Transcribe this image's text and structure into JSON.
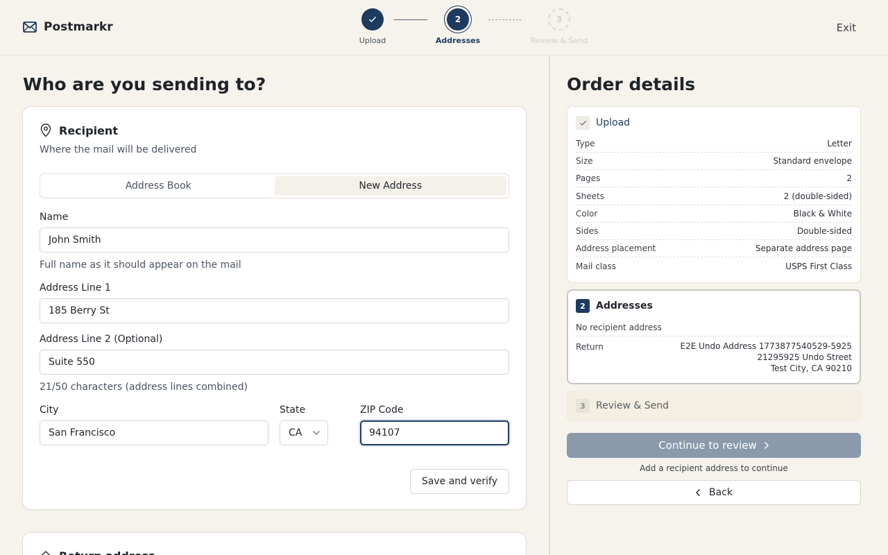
{
  "brand": {
    "name": "Postmarkr"
  },
  "header": {
    "exit_label": "Exit"
  },
  "stepper": {
    "steps": [
      {
        "number": "",
        "label": "Upload",
        "state": "done"
      },
      {
        "number": "2",
        "label": "Addresses",
        "state": "current"
      },
      {
        "number": "3",
        "label": "Review & Send",
        "state": "upcoming"
      }
    ]
  },
  "main": {
    "title": "Who are you sending to?",
    "recipient": {
      "title": "Recipient",
      "subtitle": "Where the mail will be delivered",
      "tabs": [
        "Address Book",
        "New Address"
      ],
      "active_tab": "New Address",
      "name_label": "Name",
      "name_value": "John Smith",
      "name_hint": "Full name as it should appear on the mail",
      "line1_label": "Address Line 1",
      "line1_value": "185 Berry St",
      "line2_label": "Address Line 2 (Optional)",
      "line2_value": "Suite 550",
      "char_count": "21/50 characters (address lines combined)",
      "city_label": "City",
      "city_value": "San Francisco",
      "state_label": "State",
      "state_value": "CA",
      "zip_label": "ZIP Code",
      "zip_value": "94107",
      "save_label": "Save and verify"
    },
    "return_address": {
      "title": "Return address"
    }
  },
  "order": {
    "title": "Order details",
    "upload": {
      "title": "Upload",
      "rows": [
        {
          "k": "Type",
          "v": "Letter"
        },
        {
          "k": "Size",
          "v": "Standard envelope"
        },
        {
          "k": "Pages",
          "v": "2"
        },
        {
          "k": "Sheets",
          "v": "2 (double-sided)"
        },
        {
          "k": "Color",
          "v": "Black & White"
        },
        {
          "k": "Sides",
          "v": "Double-sided"
        },
        {
          "k": "Address placement",
          "v": "Separate address page"
        },
        {
          "k": "Mail class",
          "v": "USPS First Class"
        }
      ]
    },
    "addresses": {
      "badge": "2",
      "title": "Addresses",
      "no_recipient": "No recipient address",
      "return_label": "Return",
      "return_line1": "E2E Undo Address 1773877540529-5925",
      "return_line2": "21295925 Undo Street",
      "return_line3": "Test City, CA 90210"
    },
    "review": {
      "badge": "3",
      "title": "Review & Send"
    },
    "continue_label": "Continue to review",
    "continue_helper": "Add a recipient address to continue",
    "back_label": "Back"
  }
}
